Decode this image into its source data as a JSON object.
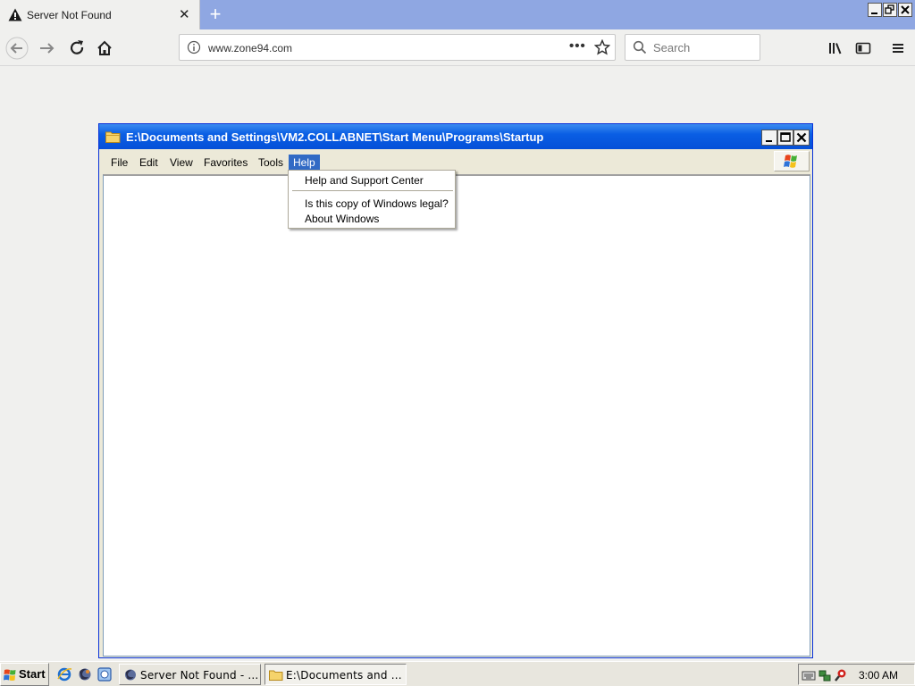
{
  "browser": {
    "tab_title": "Server Not Found",
    "new_tab_symbol": "+",
    "url": "www.zone94.com",
    "search_placeholder": "Search",
    "url_overflow": "•••",
    "close_symbol": "✕"
  },
  "explorer": {
    "title": "E:\\Documents and Settings\\VM2.COLLABNET\\Start Menu\\Programs\\Startup",
    "menu": [
      "File",
      "Edit",
      "View",
      "Favorites",
      "Tools",
      "Help"
    ],
    "active_menu": "Help",
    "help_menu": {
      "items": [
        "Help and Support Center",
        "Is this copy of Windows legal?",
        "About Windows"
      ]
    }
  },
  "taskbar": {
    "start_label": "Start",
    "buttons": [
      "Server Not Found - ...",
      "E:\\Documents and ..."
    ],
    "clock": "3:00 AM"
  },
  "colors": {
    "titlebar": "#0a5ee4",
    "tabstrip": "#8fa7e2",
    "menu_highlight": "#316ac5"
  }
}
